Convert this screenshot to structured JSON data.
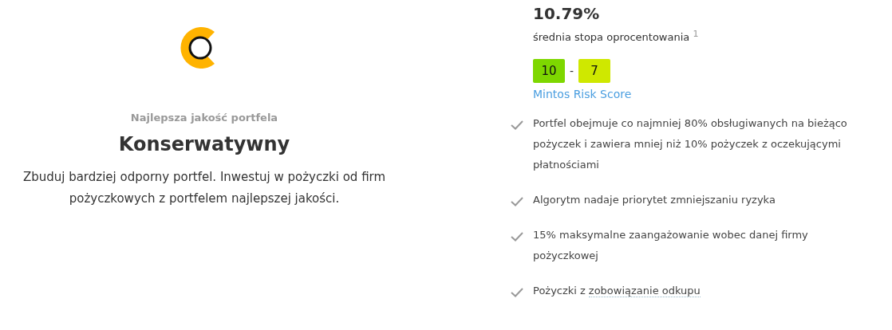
{
  "strategy": {
    "subtitle": "Najlepsza jakość portfela",
    "title": "Konserwatywny",
    "description": "Zbuduj bardziej odporny portfel. Inwestuj w pożyczki od firm pożyczkowych z portfelem najlepszej jakości."
  },
  "rate": {
    "value": "10.79%",
    "label": "średnia stopa oprocentowania",
    "footnote": "1"
  },
  "risk_score": {
    "scores": [
      {
        "value": "10",
        "color": "#7ed700"
      },
      {
        "value": "7",
        "color": "#cfe800"
      }
    ],
    "separator": "-",
    "label": "Mintos Risk Score"
  },
  "features": [
    {
      "text": "Portfel obejmuje co najmniej 80% obsługiwanych na bieżąco pożyczek i zawiera mniej niż 10% pożyczek z oczekującymi płatnościami"
    },
    {
      "text": "Algorytm nadaje priorytet zmniejszaniu ryzyka"
    },
    {
      "text": "15% maksymalne zaangażowanie wobec danej firmy pożyczkowej"
    },
    {
      "text": "Pożyczki z",
      "link": "zobowiązanie odkupu"
    }
  ]
}
